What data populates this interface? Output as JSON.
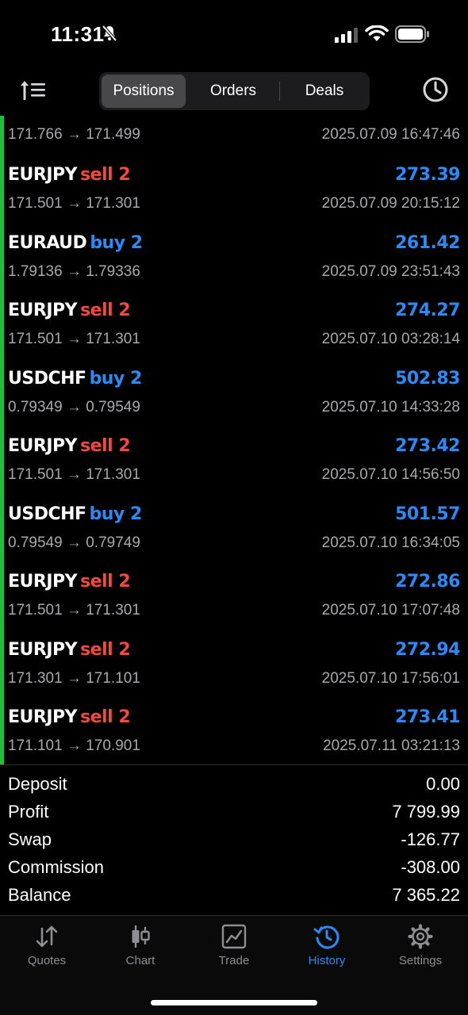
{
  "status_bar": {
    "time": "11:31"
  },
  "segments": [
    {
      "label": "Positions",
      "active": true
    },
    {
      "label": "Orders",
      "active": false
    },
    {
      "label": "Deals",
      "active": false
    }
  ],
  "partial_row": {
    "prices": "171.766 → 171.499",
    "time": "2025.07.09 16:47:46"
  },
  "deals": [
    {
      "symbol": "EURJPY",
      "side": "sell 2",
      "profit": "273.39",
      "prices": "171.501 → 171.301",
      "time": "2025.07.09 20:15:12"
    },
    {
      "symbol": "EURAUD",
      "side": "buy 2",
      "profit": "261.42",
      "prices": "1.79136 → 1.79336",
      "time": "2025.07.09 23:51:43"
    },
    {
      "symbol": "EURJPY",
      "side": "sell 2",
      "profit": "274.27",
      "prices": "171.501 → 171.301",
      "time": "2025.07.10 03:28:14"
    },
    {
      "symbol": "USDCHF",
      "side": "buy 2",
      "profit": "502.83",
      "prices": "0.79349 → 0.79549",
      "time": "2025.07.10 14:33:28"
    },
    {
      "symbol": "EURJPY",
      "side": "sell 2",
      "profit": "273.42",
      "prices": "171.501 → 171.301",
      "time": "2025.07.10 14:56:50"
    },
    {
      "symbol": "USDCHF",
      "side": "buy 2",
      "profit": "501.57",
      "prices": "0.79549 → 0.79749",
      "time": "2025.07.10 16:34:05"
    },
    {
      "symbol": "EURJPY",
      "side": "sell 2",
      "profit": "272.86",
      "prices": "171.501 → 171.301",
      "time": "2025.07.10 17:07:48"
    },
    {
      "symbol": "EURJPY",
      "side": "sell 2",
      "profit": "272.94",
      "prices": "171.301 → 171.101",
      "time": "2025.07.10 17:56:01"
    },
    {
      "symbol": "EURJPY",
      "side": "sell 2",
      "profit": "273.41",
      "prices": "171.101 → 170.901",
      "time": "2025.07.11 03:21:13"
    }
  ],
  "summary": [
    {
      "label": "Deposit",
      "value": "0.00"
    },
    {
      "label": "Profit",
      "value": "7 799.99"
    },
    {
      "label": "Swap",
      "value": "-126.77"
    },
    {
      "label": "Commission",
      "value": "-308.00"
    },
    {
      "label": "Balance",
      "value": "7 365.22"
    }
  ],
  "tabs": [
    {
      "label": "Quotes",
      "icon": "quotes-icon",
      "active": false
    },
    {
      "label": "Chart",
      "icon": "candlestick-icon",
      "active": false
    },
    {
      "label": "Trade",
      "icon": "trade-chart-icon",
      "active": false
    },
    {
      "label": "History",
      "icon": "history-icon",
      "active": true
    },
    {
      "label": "Settings",
      "icon": "gear-icon",
      "active": false
    }
  ],
  "colors": {
    "sell": "#f0493e",
    "buy": "#2f89f5",
    "profit": "#2f89f5",
    "accent_bar": "#1fbf3b",
    "active_tab": "#2f89f5"
  }
}
